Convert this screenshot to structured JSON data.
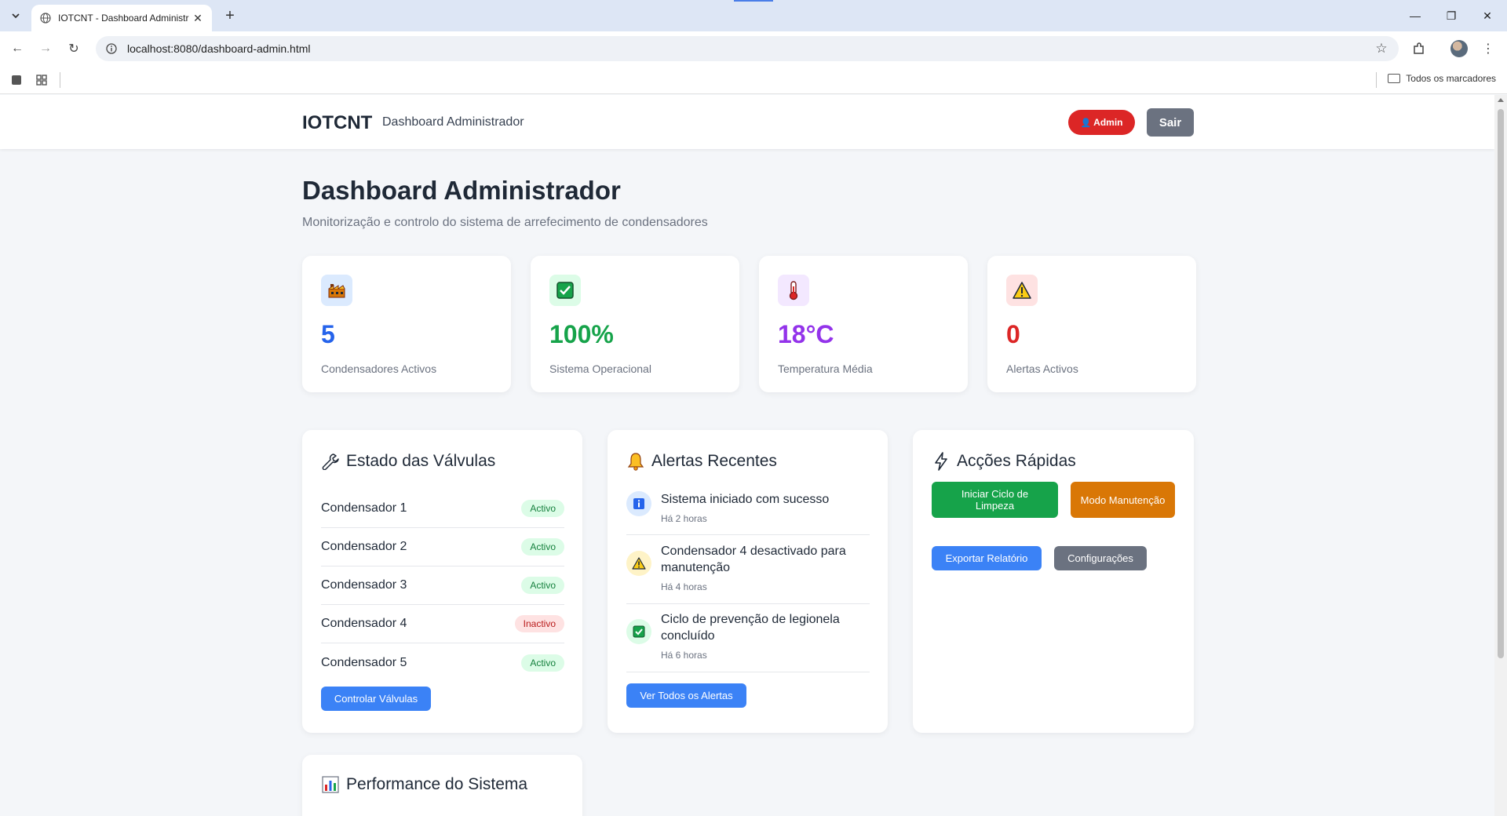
{
  "browser": {
    "tab_title": "IOTCNT - Dashboard Administr",
    "url": "localhost:8080/dashboard-admin.html",
    "bookmarks_all": "Todos os marcadores"
  },
  "header": {
    "brand": "IOTCNT",
    "subtitle": "Dashboard Administrador",
    "admin_badge": "Admin",
    "logout": "Sair"
  },
  "page": {
    "title": "Dashboard Administrador",
    "subtitle": "Monitorização e controlo do sistema de arrefecimento de condensadores"
  },
  "stats": [
    {
      "icon": "factory-icon",
      "value": "5",
      "label": "Condensadores Activos",
      "color": "#2563eb",
      "bg": "#dbeafe"
    },
    {
      "icon": "check-icon",
      "value": "100%",
      "label": "Sistema Operacional",
      "color": "#16a34a",
      "bg": "#dcfce7"
    },
    {
      "icon": "thermometer-icon",
      "value": "18°C",
      "label": "Temperatura Média",
      "color": "#9333ea",
      "bg": "#f3e8ff"
    },
    {
      "icon": "warning-icon",
      "value": "0",
      "label": "Alertas Activos",
      "color": "#dc2626",
      "bg": "#fee2e2"
    }
  ],
  "valves": {
    "title": "Estado das Válvulas",
    "items": [
      {
        "name": "Condensador 1",
        "status": "Activo"
      },
      {
        "name": "Condensador 2",
        "status": "Activo"
      },
      {
        "name": "Condensador 3",
        "status": "Activo"
      },
      {
        "name": "Condensador 4",
        "status": "Inactivo"
      },
      {
        "name": "Condensador 5",
        "status": "Activo"
      }
    ],
    "button": "Controlar Válvulas"
  },
  "alerts": {
    "title": "Alertas Recentes",
    "items": [
      {
        "icon": "info-icon",
        "text": "Sistema iniciado com sucesso",
        "time": "Há 2 horas"
      },
      {
        "icon": "warning-icon",
        "text": "Condensador 4 desactivado para manutenção",
        "time": "Há 4 horas"
      },
      {
        "icon": "check-icon",
        "text": "Ciclo de prevenção de legionela concluído",
        "time": "Há 6 horas"
      }
    ],
    "button": "Ver Todos os Alertas"
  },
  "actions": {
    "title": "Acções Rápidas",
    "start_cycle": "Iniciar Ciclo de Limpeza",
    "maintenance": "Modo Manutenção",
    "export": "Exportar Relatório",
    "settings": "Configurações"
  },
  "performance": {
    "title": "Performance do Sistema"
  }
}
